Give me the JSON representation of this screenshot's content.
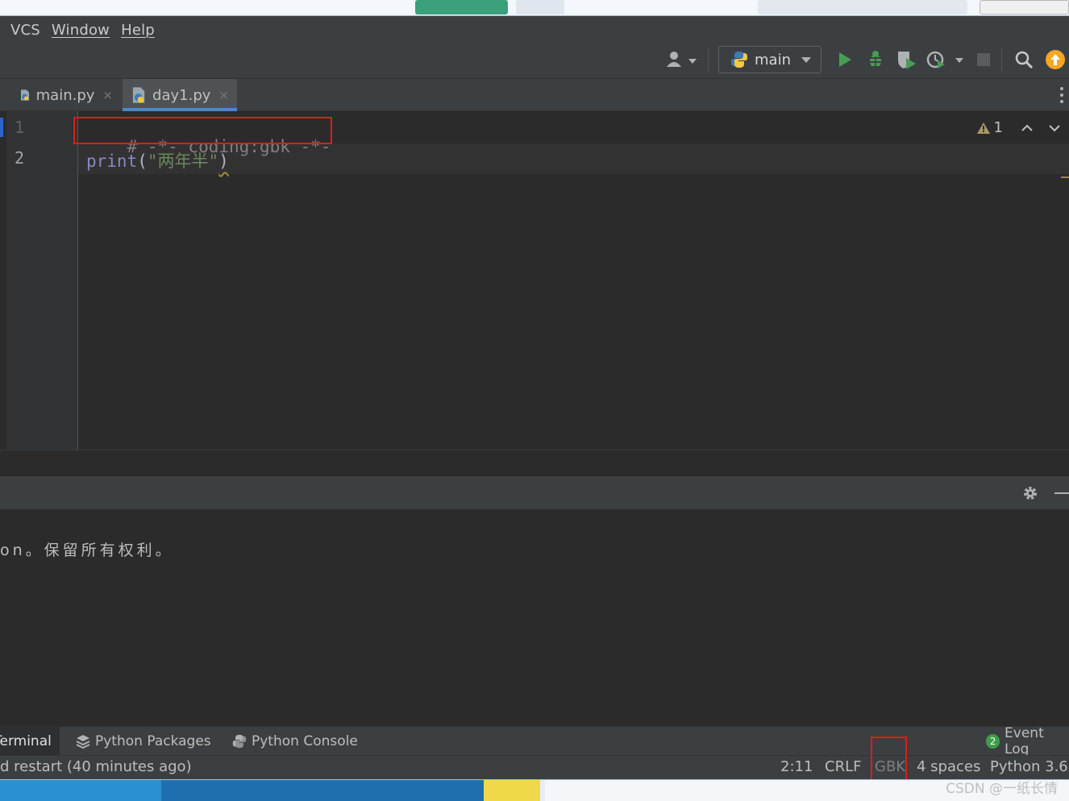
{
  "menu": {
    "items": [
      "VCS",
      "Window",
      "Help"
    ]
  },
  "toolbar": {
    "run_config_label": "main",
    "icons": [
      "user-icon",
      "python-icon",
      "run-icon",
      "debug-icon",
      "coverage-icon",
      "profile-icon",
      "stop-icon",
      "search-icon",
      "update-icon"
    ],
    "colors": {
      "run": "#499c54",
      "update": "#f5a623"
    }
  },
  "tabs": [
    {
      "name": "main.py",
      "close": "×",
      "active": false
    },
    {
      "name": "day1.py",
      "close": "×",
      "active": true
    }
  ],
  "editor": {
    "lines": [
      {
        "number": "1",
        "comment": "# -*- coding:gbk -*-"
      },
      {
        "number": "2",
        "builtin": "print",
        "open": "(",
        "string": "\"两年半\"",
        "close": ")"
      }
    ],
    "inspection_count": "1",
    "inspection_icon": "warning-icon"
  },
  "terminal": {
    "output_line": "on。保留所有权利。"
  },
  "tool_windows": {
    "terminal": "Terminal",
    "python_packages": "Python Packages",
    "python_console": "Python Console",
    "event_log": "Event Log",
    "event_count": "2"
  },
  "status": {
    "message": "d restart (40 minutes ago)",
    "position": "2:11",
    "line_separator": "CRLF",
    "encoding": "GBK",
    "indent": "4 spaces",
    "interpreter": "Python 3.6"
  },
  "watermark": "CSDN @一纸长情",
  "colors": {
    "highlight_box": "#e01b1b",
    "tab_underline": "#4a88c7",
    "string": "#6a8759",
    "builtin": "#8888c6",
    "comment": "#808080"
  }
}
